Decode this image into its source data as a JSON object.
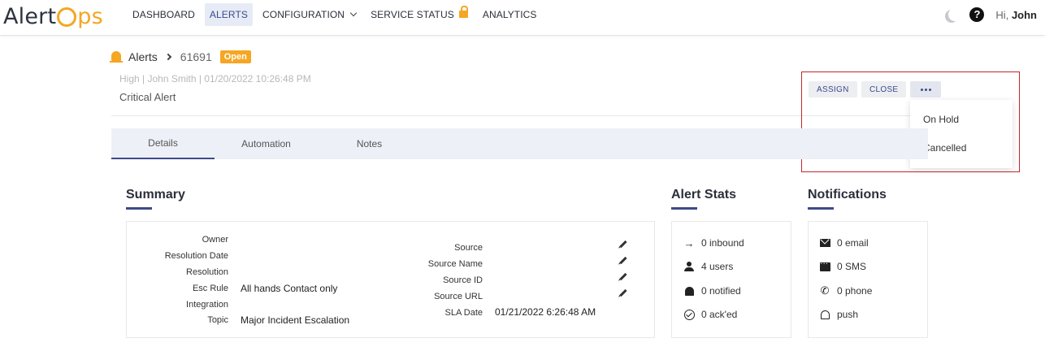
{
  "app": {
    "logo_prefix": "Alert",
    "logo_suffix": "ps",
    "greeting_prefix": "Hi,",
    "user_name": "John"
  },
  "nav": {
    "items": [
      {
        "label": "DASHBOARD"
      },
      {
        "label": "ALERTS"
      },
      {
        "label": "CONFIGURATION"
      },
      {
        "label": "SERVICE STATUS"
      },
      {
        "label": "ANALYTICS"
      }
    ]
  },
  "header": {
    "breadcrumb_root": "Alerts",
    "alert_id": "61691",
    "status_badge": "Open",
    "meta": "High | John Smith | 01/20/2022 10:26:48 PM",
    "title": "Critical Alert"
  },
  "actions": {
    "assign": "ASSIGN",
    "close": "CLOSE",
    "menu_items": [
      "On Hold",
      "Cancelled"
    ]
  },
  "tabs": [
    {
      "label": "Details"
    },
    {
      "label": "Automation"
    },
    {
      "label": "Notes"
    }
  ],
  "summary": {
    "title": "Summary",
    "left_fields": [
      {
        "label": "Owner",
        "value": ""
      },
      {
        "label": "Resolution Date",
        "value": ""
      },
      {
        "label": "Resolution",
        "value": ""
      },
      {
        "label": "Esc Rule",
        "value": "All hands Contact only"
      },
      {
        "label": "Integration",
        "value": ""
      },
      {
        "label": "Topic",
        "value": "Major Incident Escalation"
      }
    ],
    "right_fields": [
      {
        "label": "Source",
        "value": ""
      },
      {
        "label": "Source Name",
        "value": ""
      },
      {
        "label": "Source ID",
        "value": ""
      },
      {
        "label": "Source URL",
        "value": ""
      },
      {
        "label": "SLA Date",
        "value": "01/21/2022 6:26:48 AM"
      }
    ]
  },
  "alert_stats": {
    "title": "Alert Stats",
    "rows": [
      {
        "icon": "arrow-right-icon",
        "text": "0 inbound"
      },
      {
        "icon": "person-icon",
        "text": "4 users"
      },
      {
        "icon": "bell-icon",
        "text": "0 notified"
      },
      {
        "icon": "check-circle-icon",
        "text": "0 ack'ed"
      }
    ]
  },
  "notifications": {
    "title": "Notifications",
    "rows": [
      {
        "icon": "email-icon",
        "text": "0 email"
      },
      {
        "icon": "sms-icon",
        "text": "0 SMS"
      },
      {
        "icon": "phone-icon",
        "text": "0 phone"
      },
      {
        "icon": "bell-outline-icon",
        "text": "push"
      }
    ]
  },
  "colors": {
    "accent": "#3d4a8a",
    "brand_orange": "#f5a623",
    "highlight_border": "#c0282d"
  }
}
